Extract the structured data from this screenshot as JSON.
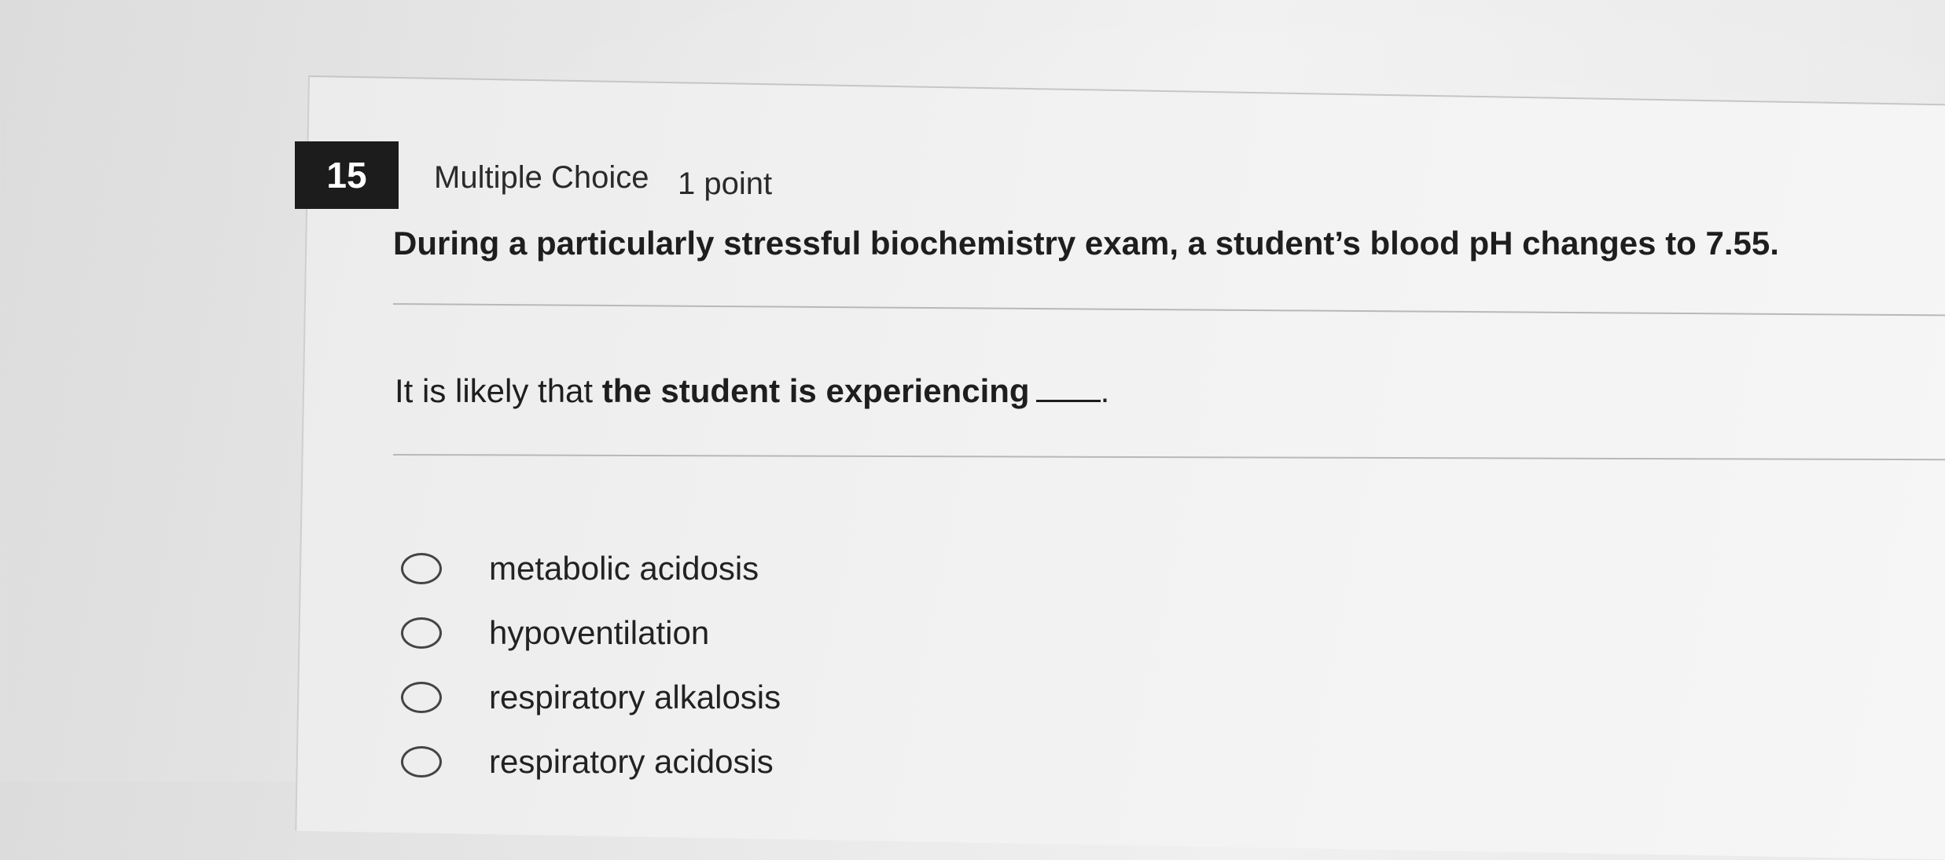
{
  "question": {
    "number": "15",
    "type": "Multiple Choice",
    "points": "1 point",
    "stem": "During a particularly stressful biochemistry exam, a student’s blood pH changes to 7.55.",
    "prompt_lead": "It is likely that",
    "prompt_bold": "the student is experiencing",
    "prompt_end": "."
  },
  "options": [
    {
      "label": "metabolic acidosis"
    },
    {
      "label": "hypoventilation"
    },
    {
      "label": "respiratory alkalosis"
    },
    {
      "label": "respiratory acidosis"
    }
  ]
}
